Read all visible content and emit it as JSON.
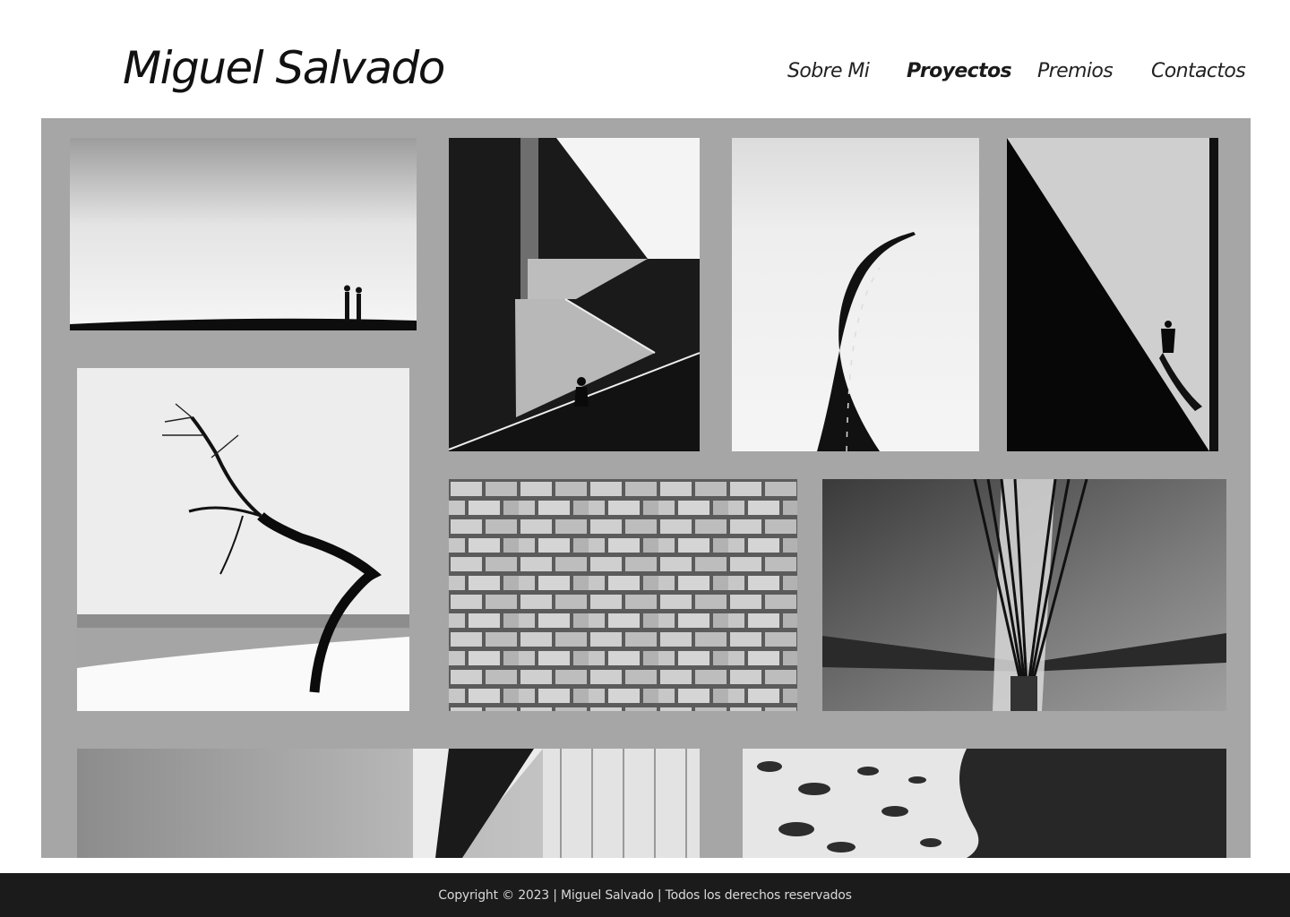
{
  "site": {
    "title": "Miguel Salvado"
  },
  "nav": {
    "items": [
      {
        "label": "Sobre Mi",
        "active": false
      },
      {
        "label": "Proyectos",
        "active": true
      },
      {
        "label": "Premios",
        "active": false
      },
      {
        "label": "Contactos",
        "active": false
      }
    ]
  },
  "gallery": {
    "background": "#a6a6a6",
    "photos": [
      {
        "subject": "couple-silhouette-horizon"
      },
      {
        "subject": "geometric-stairs-figure"
      },
      {
        "subject": "winding-road-snow"
      },
      {
        "subject": "diagonal-wall-figure-shadow"
      },
      {
        "subject": "bent-tree-lakeshore"
      },
      {
        "subject": "brick-wall"
      },
      {
        "subject": "bridge-cables-pylon"
      },
      {
        "subject": "building-facade-sky"
      },
      {
        "subject": "aerial-beach-waves"
      }
    ]
  },
  "footer": {
    "text": "Copyright © 2023 | Miguel Salvado | Todos los derechos reservados"
  }
}
